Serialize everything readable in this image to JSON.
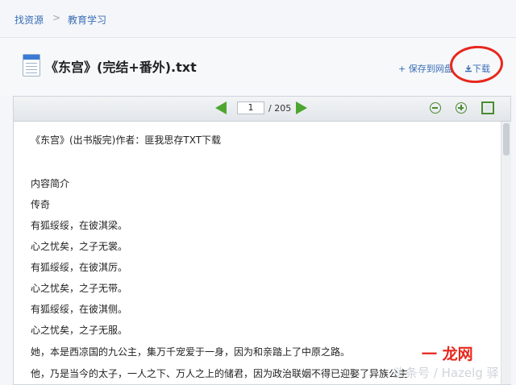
{
  "breadcrumb": {
    "home": "找资源",
    "separator": ">",
    "category": "教育学习"
  },
  "file": {
    "title": "《东宫》(完结+番外).txt"
  },
  "actions": {
    "save": "+ 保存到网盘",
    "download": "下载"
  },
  "toolbar": {
    "current_page": "1",
    "total_pages": "/ 205"
  },
  "document": {
    "lines": [
      "《东宫》(出书版完)作者：匪我思存TXT下载",
      "",
      "内容简介",
      "传奇",
      "有狐绥绥，在彼淇梁。",
      "心之忧矣，之子无裳。",
      "有狐绥绥，在彼淇厉。",
      "心之忧矣，之子无带。",
      "有狐绥绥，在彼淇侧。",
      "心之忧矣，之子无服。",
      "她，本是西凉国的九公主，集万千宠爱于一身，因为和亲踏上了中原之路。",
      "他，乃是当今的太子，一人之下、万人之上的储君，因为政治联姻不得已迎娶了异族公主"
    ]
  },
  "watermark": {
    "text": "头条号 / Hazelg 驿",
    "logo": "一 龙网"
  },
  "colors": {
    "link": "#3a6db5",
    "accent": "#4da62f",
    "annotation": "#e8261c"
  },
  "icons": {
    "file": "txt-file-icon",
    "prev": "prev-page-icon",
    "next": "next-page-icon",
    "zoom_out": "zoom-out-icon",
    "zoom_in": "zoom-in-icon",
    "fullscreen": "fullscreen-icon"
  }
}
